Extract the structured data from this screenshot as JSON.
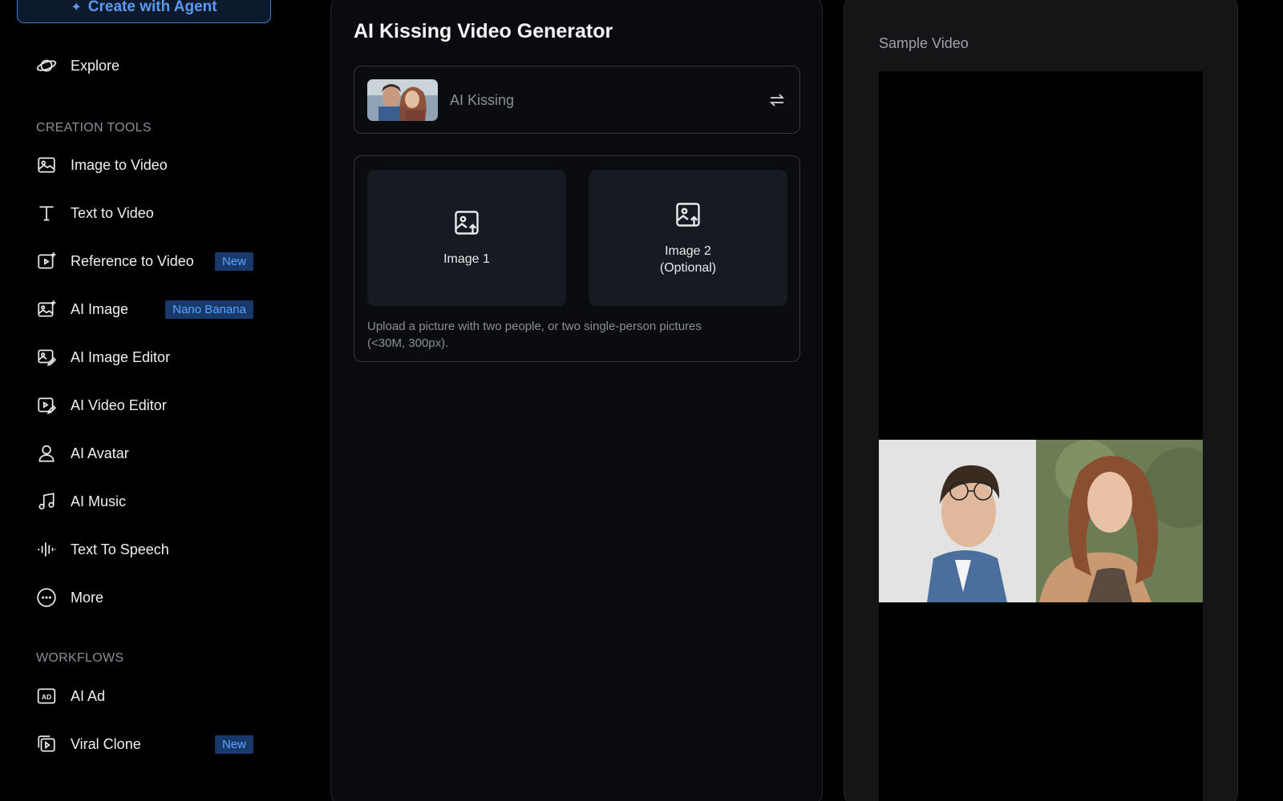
{
  "sidebar": {
    "agent_button": "Create with Agent",
    "explore": "Explore",
    "creation_tools_label": "CREATION TOOLS",
    "creation_tools": [
      {
        "label": "Image to Video",
        "icon": "image-icon"
      },
      {
        "label": "Text to Video",
        "icon": "text-t-icon"
      },
      {
        "label": "Reference to Video",
        "icon": "reference-video-icon",
        "badge": "New"
      },
      {
        "label": "AI Image",
        "icon": "ai-image-icon",
        "badge": "Nano Banana"
      },
      {
        "label": "AI Image Editor",
        "icon": "image-edit-icon"
      },
      {
        "label": "AI Video Editor",
        "icon": "video-edit-icon"
      },
      {
        "label": "AI Avatar",
        "icon": "avatar-icon"
      },
      {
        "label": "AI Music",
        "icon": "music-note-icon"
      },
      {
        "label": "Text To Speech",
        "icon": "waveform-icon"
      },
      {
        "label": "More",
        "icon": "more-dots-icon"
      }
    ],
    "workflows_label": "WORKFLOWS",
    "workflows": [
      {
        "label": "AI Ad",
        "icon": "ad-icon"
      },
      {
        "label": "Viral Clone",
        "icon": "clone-icon",
        "badge": "New"
      }
    ]
  },
  "main": {
    "title": "AI Kissing Video Generator",
    "template_name": "AI Kissing",
    "slot1_label": "Image 1",
    "slot2_label_line1": "Image 2",
    "slot2_label_line2": "(Optional)",
    "hint_line1": "Upload a picture with two people, or two single-person pictures",
    "hint_line2": "(<30M, 300px)."
  },
  "sample": {
    "label": "Sample Video"
  },
  "colors": {
    "accent": "#3d7bd6",
    "badge_bg": "#173a6b",
    "badge_text": "#5fa1ff"
  }
}
